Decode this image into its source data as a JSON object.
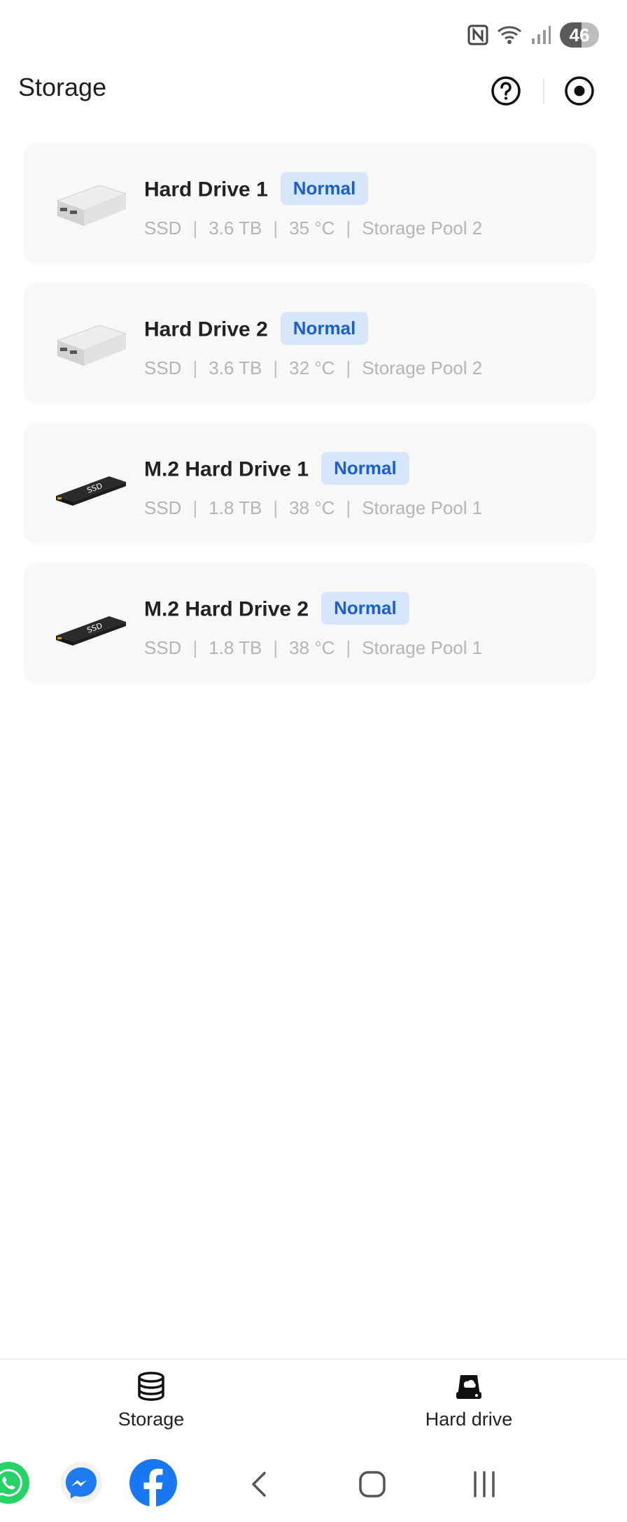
{
  "status_bar": {
    "battery_level": "46",
    "icons": [
      "nfc-icon",
      "wifi-icon",
      "signal-icon",
      "battery-icon"
    ]
  },
  "header": {
    "title": "Storage",
    "help_icon": "help-circle-icon",
    "record_icon": "record-icon"
  },
  "drives": [
    {
      "name": "Hard Drive 1",
      "status": "Normal",
      "type": "SSD",
      "capacity": "3.6 TB",
      "temperature": "35 °C",
      "pool": "Storage Pool 2",
      "image": "sata-drive"
    },
    {
      "name": "Hard Drive 2",
      "status": "Normal",
      "type": "SSD",
      "capacity": "3.6 TB",
      "temperature": "32 °C",
      "pool": "Storage Pool 2",
      "image": "sata-drive"
    },
    {
      "name": "M.2 Hard Drive 1",
      "status": "Normal",
      "type": "SSD",
      "capacity": "1.8 TB",
      "temperature": "38 °C",
      "pool": "Storage Pool 1",
      "image": "m2-drive"
    },
    {
      "name": "M.2 Hard Drive 2",
      "status": "Normal",
      "type": "SSD",
      "capacity": "1.8 TB",
      "temperature": "38 °C",
      "pool": "Storage Pool 1",
      "image": "m2-drive"
    }
  ],
  "drive_image_label": "SSD",
  "bottom_nav": {
    "storage_label": "Storage",
    "hard_drive_label": "Hard drive"
  },
  "colors": {
    "badge_bg": "#d8e6fb",
    "badge_text": "#1a5ed6",
    "card_bg": "#f8f8f8"
  }
}
